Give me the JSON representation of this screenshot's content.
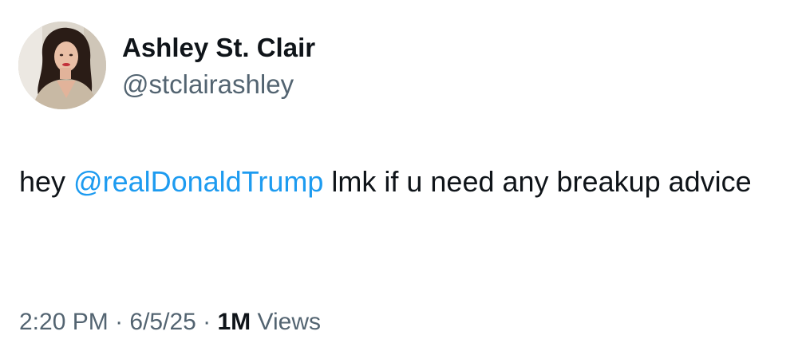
{
  "author": {
    "display_name": "Ashley St. Clair",
    "handle": "@stclairashley",
    "avatar_icon": "profile-photo"
  },
  "tweet": {
    "text_before": "hey ",
    "mention": "@realDonaldTrump",
    "text_after": " lmk if u need any breakup advice"
  },
  "meta": {
    "time": "2:20 PM",
    "separator": " · ",
    "date": "6/5/25",
    "views_count": "1M",
    "views_label": " Views"
  },
  "colors": {
    "mention": "#1d9bf0",
    "text": "#0f1419",
    "muted": "#536471"
  }
}
